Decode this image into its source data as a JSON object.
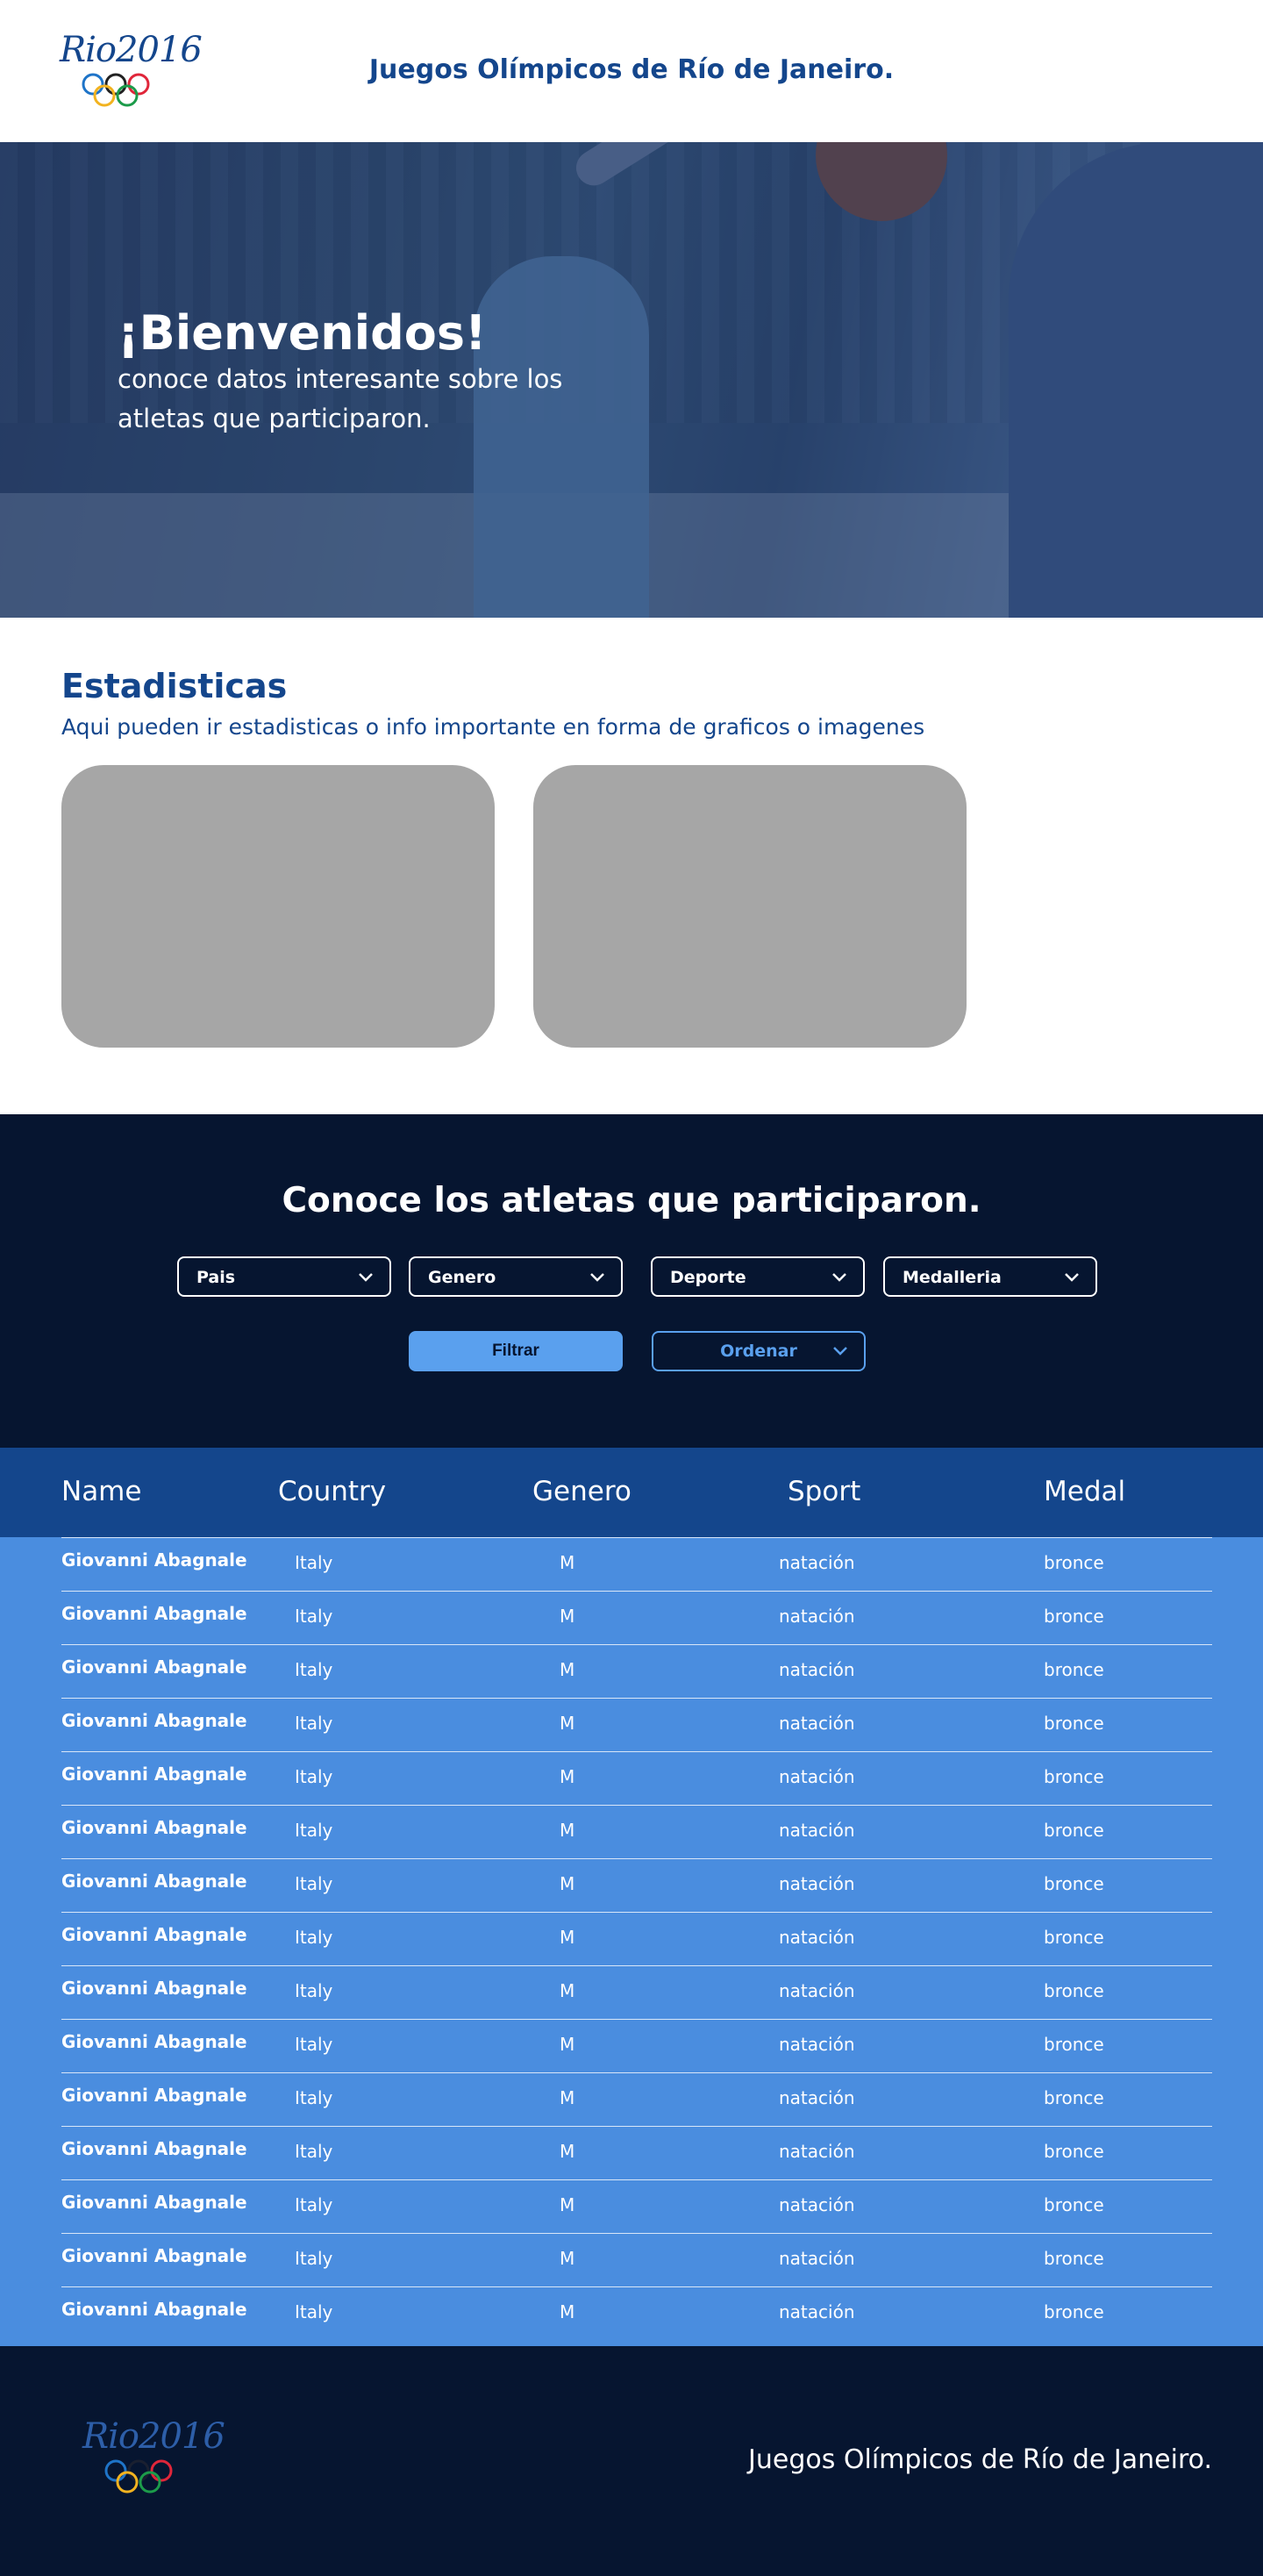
{
  "header": {
    "logo_text": "Rio2016",
    "title": "Juegos Olímpicos de Río de Janeiro."
  },
  "hero": {
    "title": "¡Bienvenidos!",
    "subtitle": "conoce datos interesante sobre los atletas que participaron."
  },
  "stats": {
    "title": "Estadisticas",
    "subtitle": "Aqui pueden ir estadisticas o info importante en forma de graficos o imagenes"
  },
  "athletes": {
    "title": "Conoce los atletas que participaron.",
    "filters": {
      "pais": "Pais",
      "genero": "Genero",
      "deporte": "Deporte",
      "medalleria": "Medalleria"
    },
    "filter_button": "Filtrar",
    "sort_button": "Ordenar"
  },
  "table": {
    "headers": {
      "name": "Name",
      "country": "Country",
      "genero": "Genero",
      "sport": "Sport",
      "medal": "Medal"
    },
    "rows": [
      {
        "name": "Giovanni Abagnale",
        "country": "Italy",
        "genero": "M",
        "sport": "natación",
        "medal": "bronce"
      },
      {
        "name": "Giovanni Abagnale",
        "country": "Italy",
        "genero": "M",
        "sport": "natación",
        "medal": "bronce"
      },
      {
        "name": "Giovanni Abagnale",
        "country": "Italy",
        "genero": "M",
        "sport": "natación",
        "medal": "bronce"
      },
      {
        "name": "Giovanni Abagnale",
        "country": "Italy",
        "genero": "M",
        "sport": "natación",
        "medal": "bronce"
      },
      {
        "name": "Giovanni Abagnale",
        "country": "Italy",
        "genero": "M",
        "sport": "natación",
        "medal": "bronce"
      },
      {
        "name": "Giovanni Abagnale",
        "country": "Italy",
        "genero": "M",
        "sport": "natación",
        "medal": "bronce"
      },
      {
        "name": "Giovanni Abagnale",
        "country": "Italy",
        "genero": "M",
        "sport": "natación",
        "medal": "bronce"
      },
      {
        "name": "Giovanni Abagnale",
        "country": "Italy",
        "genero": "M",
        "sport": "natación",
        "medal": "bronce"
      },
      {
        "name": "Giovanni Abagnale",
        "country": "Italy",
        "genero": "M",
        "sport": "natación",
        "medal": "bronce"
      },
      {
        "name": "Giovanni Abagnale",
        "country": "Italy",
        "genero": "M",
        "sport": "natación",
        "medal": "bronce"
      },
      {
        "name": "Giovanni Abagnale",
        "country": "Italy",
        "genero": "M",
        "sport": "natación",
        "medal": "bronce"
      },
      {
        "name": "Giovanni Abagnale",
        "country": "Italy",
        "genero": "M",
        "sport": "natación",
        "medal": "bronce"
      },
      {
        "name": "Giovanni Abagnale",
        "country": "Italy",
        "genero": "M",
        "sport": "natación",
        "medal": "bronce"
      },
      {
        "name": "Giovanni Abagnale",
        "country": "Italy",
        "genero": "M",
        "sport": "natación",
        "medal": "bronce"
      },
      {
        "name": "Giovanni Abagnale",
        "country": "Italy",
        "genero": "M",
        "sport": "natación",
        "medal": "bronce"
      }
    ]
  },
  "footer": {
    "logo_text": "Rio2016",
    "title": "Juegos Olímpicos de Río de Janeiro."
  },
  "icons": {
    "logo": "olympic-rings-icon",
    "dropdown": "chevron-down-icon"
  },
  "colors": {
    "primary": "#14468c",
    "dark": "#061530",
    "accent": "#5aa0ee",
    "table_body": "#4a8ddf",
    "card": "#a6a6a6"
  }
}
